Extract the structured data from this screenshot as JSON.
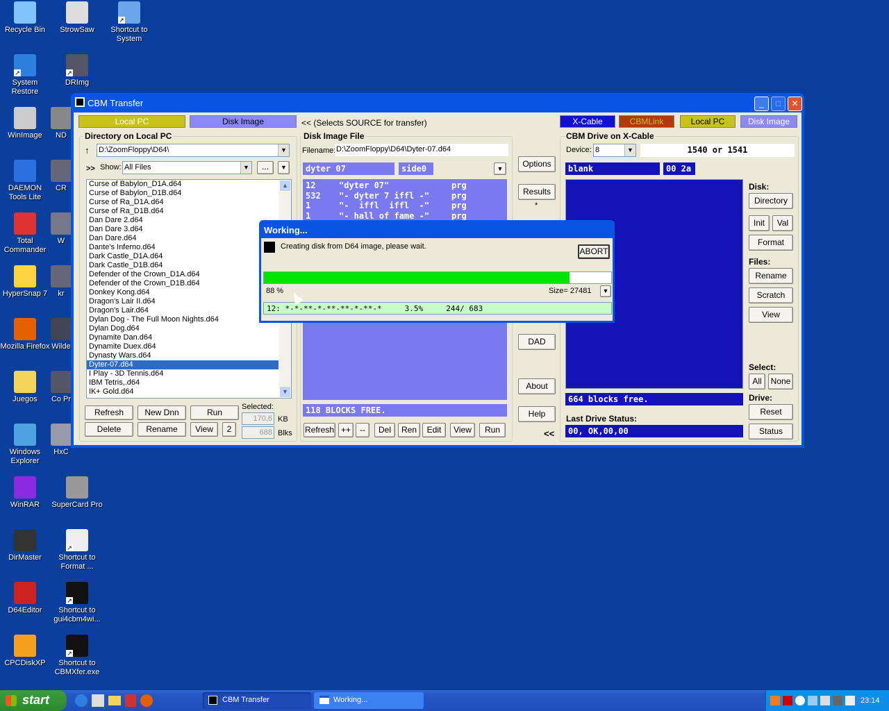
{
  "desktop": {
    "icons": [
      {
        "label": "Recycle Bin",
        "name": "recycle-bin-icon"
      },
      {
        "label": "StrowSaw",
        "name": "strowsaw-icon"
      },
      {
        "label": "Shortcut to System",
        "name": "system-shortcut-icon"
      },
      {
        "label": "System Restore",
        "name": "system-restore-icon"
      },
      {
        "label": "DRImg",
        "name": "drimg-icon"
      },
      {
        "label": "WinImage",
        "name": "winimage-icon"
      },
      {
        "label": "ND",
        "name": "nd-icon"
      },
      {
        "label": "DAEMON Tools Lite",
        "name": "daemon-tools-icon"
      },
      {
        "label": "CR",
        "name": "cr-icon"
      },
      {
        "label": "Total Commander",
        "name": "total-commander-icon"
      },
      {
        "label": "W",
        "name": "w-icon"
      },
      {
        "label": "HyperSnap 7",
        "name": "hypersnap-icon"
      },
      {
        "label": "kr",
        "name": "kr-icon"
      },
      {
        "label": "Mozilla Firefox",
        "name": "firefox-icon"
      },
      {
        "label": "Wilde",
        "name": "wilde-icon"
      },
      {
        "label": "Juegos",
        "name": "folder-icon"
      },
      {
        "label": "Co Pr",
        "name": "co-icon"
      },
      {
        "label": "Windows Explorer",
        "name": "windows-explorer-icon"
      },
      {
        "label": "HxC",
        "name": "hxc-icon"
      },
      {
        "label": "WinRAR",
        "name": "winrar-icon"
      },
      {
        "label": "SuperCard Pro",
        "name": "supercard-icon"
      },
      {
        "label": "DirMaster",
        "name": "dirmaster-icon"
      },
      {
        "label": "Shortcut to Format ...",
        "name": "format-shortcut-icon"
      },
      {
        "label": "D64Editor",
        "name": "d64editor-icon"
      },
      {
        "label": "Shortcut to gui4cbm4wi...",
        "name": "gui4cbm-shortcut-icon"
      },
      {
        "label": "CPCDiskXP",
        "name": "cpcdiskxp-icon"
      },
      {
        "label": "Shortcut to CBMXfer.exe",
        "name": "cbmxfer-shortcut-icon"
      }
    ]
  },
  "window": {
    "title": "CBM Transfer",
    "source_tabs": {
      "local_pc": "Local PC",
      "disk_image": "Disk Image",
      "hint": "<< (Selects SOURCE for transfer)"
    },
    "dest_tabs": {
      "xcable": "X-Cable",
      "cbmlink": "CBMLink",
      "local_pc": "Local PC",
      "disk_image": "Disk Image"
    },
    "local": {
      "group_title": "Directory on Local PC",
      "path": "D:\\ZoomFloppy\\D64\\",
      "show_label": "Show:",
      "show_value": "All Files",
      "browse_label": "...",
      "expand_label": ">>",
      "files": [
        "Curse of Babylon_D1A.d64",
        "Curse of Babylon_D1B.d64",
        "Curse of Ra_D1A.d64",
        "Curse of Ra_D1B.d64",
        "Dan Dare 2.d64",
        "Dan Dare 3.d64",
        "Dan Dare.d64",
        "Dante's Inferno.d64",
        "Dark Castle_D1A.d64",
        "Dark Castle_D1B.d64",
        "Defender of the Crown_D1A.d64",
        "Defender of the Crown_D1B.d64",
        "Donkey Kong.d64",
        "Dragon's Lair II.d64",
        "Dragon's Lair.d64",
        "Dylan Dog - The Full Moon Nights.d64",
        "Dylan Dog.d64",
        "Dynamite Dan.d64",
        "Dynamite Duex.d64",
        "Dynasty Wars.d64",
        "Dyter-07.d64",
        "I Play - 3D Tennis.d64",
        "IBM Tetris,.d64",
        "IK+ Gold.d64"
      ],
      "selected_index": 20,
      "buttons": {
        "refresh": "Refresh",
        "new_dnn": "New Dnn",
        "run": "Run",
        "delete": "Delete",
        "rename": "Rename",
        "view": "View",
        "two": "2"
      },
      "selected_label": "Selected:",
      "selected_kb": "170,6",
      "kb_unit": "KB",
      "selected_blks": "688",
      "blks_unit": "Blks"
    },
    "image": {
      "group_title": "Disk Image File",
      "filename_label": "Filename:",
      "filename": "D:\\ZoomFloppy\\D64\\Dyter-07.d64",
      "disk_name": "dyter 07",
      "disk_id": "side0",
      "entries": [
        {
          "blocks": "12",
          "name": "\"dyter 07\"",
          "type": "prg"
        },
        {
          "blocks": "532",
          "name": "\"- dyter 7 iffl -\"",
          "type": "prg"
        },
        {
          "blocks": "1",
          "name": "\"-  iffl  iffl  -\"",
          "type": "prg"
        },
        {
          "blocks": "1",
          "name": "\"- hall of fame -\"",
          "type": "prg"
        }
      ],
      "blocks_free": "118 BLOCKS FREE.",
      "buttons": {
        "refresh": "Refresh",
        "plusplus": "++",
        "minusminus": "--",
        "del": "Del",
        "ren": "Ren",
        "edit": "Edit",
        "view": "View",
        "run": "Run"
      }
    },
    "middle": {
      "options": "Options",
      "results": "Results",
      "star": "*",
      "dad": "DAD",
      "about": "About",
      "help": "Help",
      "arrows": "<<"
    },
    "drive": {
      "group_title": "CBM Drive on X-Cable",
      "device_label": "Device:",
      "device": "8",
      "model": "1540 or 1541",
      "disk_name": "blank",
      "disk_id": "00 2a",
      "blocks_free": "664 blocks free.",
      "last_status_label": "Last Drive Status:",
      "last_status": "00, OK,00,00",
      "disk_label": "Disk:",
      "files_label": "Files:",
      "select_label": "Select:",
      "drive_label": "Drive:",
      "buttons": {
        "directory": "Directory",
        "init": "Init",
        "val": "Val",
        "format": "Format",
        "rename": "Rename",
        "scratch": "Scratch",
        "view": "View",
        "all": "All",
        "none": "None",
        "reset": "Reset",
        "status": "Status"
      }
    }
  },
  "dialog": {
    "title": "Working...",
    "message": "Creating disk from D64 image, please wait.",
    "abort": "ABORT",
    "progress": 0.88,
    "percent": "88 %",
    "size": "Size= 27481",
    "log": "12: *-*-**-*-**-**-*-**-*     3.5%     244/ 683"
  },
  "taskbar": {
    "start": "start",
    "tasks": [
      "CBM Transfer",
      "Working..."
    ],
    "clock": "23:14"
  },
  "colors": {
    "desktop": "#0a3f9e",
    "xp_blue": "#0854e3",
    "c64_light": "#7b79f0",
    "c64_dark": "#1313b8",
    "progress": "#00e600"
  }
}
